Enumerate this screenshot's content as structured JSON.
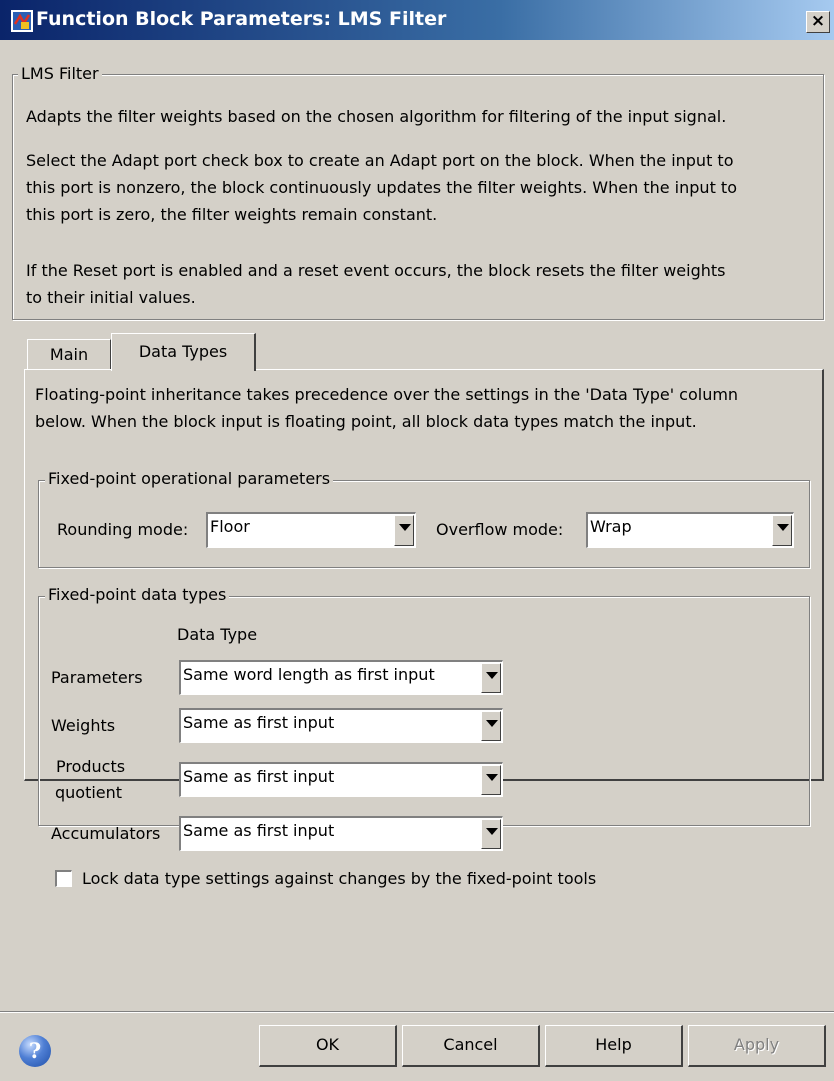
{
  "window": {
    "title": "Function Block Parameters: LMS Filter",
    "close_symbol": "×"
  },
  "description": {
    "legend": "LMS Filter",
    "para1_line1": "Adapts the filter weights based on the chosen algorithm for filtering of the input signal.",
    "para2_line1": "Select the Adapt port check box to create an Adapt port on the block. When the input to",
    "para2_line2": "this port is nonzero, the block continuously updates the filter weights. When the input to",
    "para2_line3": "this port is zero, the filter weights remain constant.",
    "para3_line1": "If the Reset port is enabled and a reset event occurs, the block resets the filter weights",
    "para3_line2": "to their initial values."
  },
  "tabs": [
    {
      "label": "Main",
      "active": false
    },
    {
      "label": "Data Types",
      "active": true
    }
  ],
  "data_types_tab": {
    "intro_line1": "Floating-point inheritance takes precedence over the settings in the 'Data Type' column",
    "intro_line2": "below. When the block input is floating point, all block data types match the input.",
    "operational": {
      "legend": "Fixed-point operational parameters",
      "rounding_label": "Rounding mode:",
      "rounding_value": "Floor",
      "overflow_label": "Overflow mode:",
      "overflow_value": "Wrap"
    },
    "datatypes": {
      "legend": "Fixed-point data types",
      "column_header": "Data Type",
      "rows": [
        {
          "label": "Parameters",
          "value": "Same word length as first input"
        },
        {
          "label": "Weights",
          "value": "Same as first input"
        },
        {
          "label_line1": "Products",
          "label_line2": "quotient",
          "value": "Same as first input"
        },
        {
          "label": "Accumulators",
          "value": "Same as first input"
        }
      ],
      "lock_label": "Lock data type settings against changes by the fixed-point tools",
      "lock_checked": false
    }
  },
  "buttons": {
    "ok": "OK",
    "cancel": "Cancel",
    "help": "Help",
    "apply": "Apply",
    "apply_enabled": false
  },
  "colors": {
    "dialog_bg": "#d4d0c8",
    "titlebar_start": "#0a246a",
    "titlebar_end": "#a6caf0"
  },
  "icons": {
    "title_icon": "simulink-block-icon",
    "help_icon": "question-mark-icon"
  }
}
